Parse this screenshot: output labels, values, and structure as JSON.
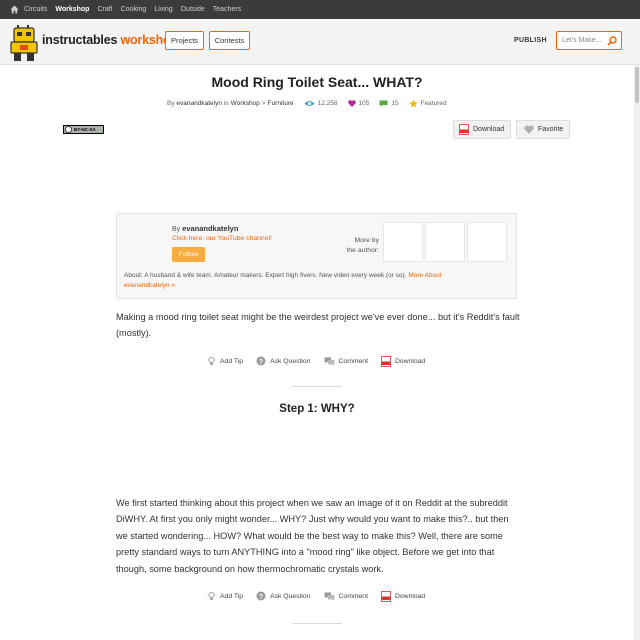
{
  "topnav": {
    "categories": [
      "Circuits",
      "Workshop",
      "Craft",
      "Cooking",
      "Living",
      "Outside",
      "Teachers"
    ]
  },
  "header": {
    "logo_word1": "instructables",
    "logo_word2": "workshop",
    "projects_label": "Projects",
    "contests_label": "Contests",
    "publish_label": "PUBLISH",
    "search_placeholder": "Let's Make..."
  },
  "article": {
    "title": "Mood Ring Toilet Seat... WHAT?",
    "by_prefix": "By",
    "author": "evanandkatelyn",
    "in_word": "in",
    "category": "Workshop",
    "breadcrumb_sep": ">",
    "subcategory": "Furniture",
    "views": "12,258",
    "favorites": "105",
    "comments": "15",
    "featured_label": "Featured",
    "license_text": "BY-NC-SA",
    "download_label": "Download",
    "favorite_label": "Favorite"
  },
  "author_box": {
    "by_prefix": "By",
    "name": "evanandkatelyn",
    "youtube_link": "Click here: our YouTube channel!",
    "follow_label": "Follow",
    "more_by_line1": "More by",
    "more_by_line2": "the author:",
    "about_text": "About: A husband & wife team. Amateur makers. Expert high fivers. New video every week (or so). ",
    "more_about_link": "More About evanandkatelyn »"
  },
  "intro_text": "Making a mood ring toilet seat might be the weirdest project we've ever done... but it's Reddit's fault (mostly).",
  "actions": {
    "add_tip": "Add Tip",
    "ask_question": "Ask Question",
    "comment": "Comment",
    "download": "Download"
  },
  "step1": {
    "title": "Step 1: WHY?",
    "text": "We first started thinking about this project when we saw an image of it on Reddit at the subreddit DiWHY. At first you only might wonder... WHY? Just why would you want to make this?.. but then we started wondering... HOW? What would be the best way to make this? Well, there are some pretty standard ways to turn ANYTHING into a \"mood ring\" like object. Before we get into that though, some background on how thermochromatic crystals work."
  },
  "colors": {
    "accent": "#fa6400",
    "nav_bg": "#3b3b3b",
    "follow_bg": "#f8ab3e",
    "views_icon": "#3ea1d6",
    "favorites_icon": "#b5279e",
    "comments_icon": "#5aa637",
    "featured_icon": "#f5b800"
  },
  "icons": [
    "home-icon",
    "instructables-robot-logo",
    "search-icon",
    "views-icon",
    "heart-icon",
    "comment-bubble-icon",
    "star-icon",
    "pdf-icon",
    "lightbulb-icon",
    "question-icon"
  ]
}
